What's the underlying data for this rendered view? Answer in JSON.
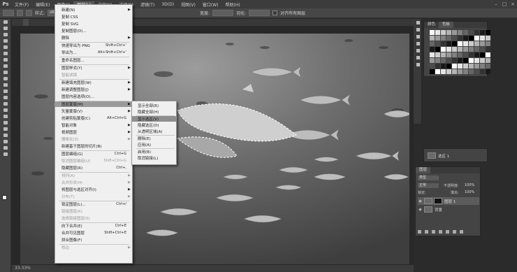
{
  "app": {
    "logo": "Ps"
  },
  "menubar": {
    "items": [
      "文件(F)",
      "编辑(E)",
      "图像(I)",
      "图层(L)",
      "文字(Y)",
      "选择(S)",
      "滤镜(T)",
      "3D(D)",
      "视图(V)",
      "窗口(W)",
      "帮助(H)"
    ],
    "active_index": 3
  },
  "options_bar": {
    "style_label": "样式:",
    "style_value": "sRGB",
    "check_label": "对齐所有图层",
    "width_label": "宽度:",
    "feather_label": "羽化:"
  },
  "document": {
    "tab_label": ""
  },
  "status_bar": {
    "text": "33.33%"
  },
  "menu": {
    "items": [
      {
        "label": "新建(N)",
        "arrow": true
      },
      {
        "label": "复制 CSS"
      },
      {
        "label": "复制 SVG"
      },
      {
        "label": "复制图层(D)..."
      },
      {
        "label": "删除",
        "arrow": true
      },
      {
        "label": "快速导出为 PNG",
        "shortcut": "Shift+Ctrl+'"
      },
      {
        "label": "导出为...",
        "shortcut": "Alt+Shift+Ctrl+'"
      },
      {
        "label": "重命名图层..."
      },
      {
        "label": "图层样式(Y)",
        "arrow": true
      },
      {
        "label": "智能滤镜",
        "disabled": true
      },
      {
        "label": "新建填充图层(W)",
        "arrow": true
      },
      {
        "label": "新建调整图层(J)",
        "arrow": true
      },
      {
        "label": "图层内容选项(O)..."
      },
      {
        "label": "图层蒙版(M)",
        "arrow": true,
        "highlight": true
      },
      {
        "label": "矢量蒙版(V)",
        "arrow": true
      },
      {
        "label": "创建剪贴蒙版(C)",
        "shortcut": "Alt+Ctrl+G"
      },
      {
        "label": "智能对象",
        "arrow": true
      },
      {
        "label": "视频图层",
        "arrow": true
      },
      {
        "label": "栅格化(Z)",
        "arrow": true,
        "disabled": true
      },
      {
        "label": "新建基于图层的切片(B)"
      },
      {
        "label": "图层编组(G)",
        "shortcut": "Ctrl+G"
      },
      {
        "label": "取消图层编组(U)",
        "shortcut": "Shift+Ctrl+G",
        "disabled": true
      },
      {
        "label": "隐藏图层(R)",
        "shortcut": "Ctrl+,"
      },
      {
        "label": "排列(A)",
        "arrow": true,
        "disabled": true
      },
      {
        "label": "合并形状(H)",
        "arrow": true,
        "disabled": true
      },
      {
        "label": "将图层与选区对齐(I)",
        "arrow": true
      },
      {
        "label": "分布(T)",
        "arrow": true,
        "disabled": true
      },
      {
        "label": "锁定图层(L)...",
        "shortcut": "Ctrl+/"
      },
      {
        "label": "链接图层(K)",
        "disabled": true
      },
      {
        "label": "选择链接图层(S)",
        "disabled": true
      },
      {
        "label": "向下合并(E)",
        "shortcut": "Ctrl+E"
      },
      {
        "label": "合并可见图层",
        "shortcut": "Shift+Ctrl+E"
      },
      {
        "label": "拼合图像(F)"
      },
      {
        "label": "修边",
        "arrow": true,
        "disabled": true
      }
    ]
  },
  "submenu": {
    "items": [
      {
        "label": "显示全部(R)"
      },
      {
        "label": "隐藏全部(H)"
      },
      {
        "label": "显示选区(V)",
        "highlight": true
      },
      {
        "label": "隐藏选区(D)"
      },
      {
        "label": "从透明区域(A)"
      },
      {
        "label": "删除(E)"
      },
      {
        "label": "应用(A)"
      },
      {
        "label": "启用(B)"
      },
      {
        "label": "取消链接(L)"
      }
    ]
  },
  "panels": {
    "swatches": {
      "tab1": "颜色",
      "tab2": "色板"
    },
    "history": {
      "label": "选区 1"
    },
    "layers": {
      "title": "图层",
      "kind_label": "类型",
      "blend_mode": "正常",
      "opacity_label": "不透明度:",
      "opacity_value": "100%",
      "lock_label": "锁定:",
      "fill_label": "填充:",
      "fill_value": "100%",
      "rows": [
        {
          "name": "图层 1",
          "has_mask": true
        },
        {
          "name": "背景"
        }
      ]
    }
  },
  "colors": {
    "menu_bg": "#f0f0f0",
    "highlight": "#9a9a9a",
    "dock": "#2b2b2b"
  }
}
